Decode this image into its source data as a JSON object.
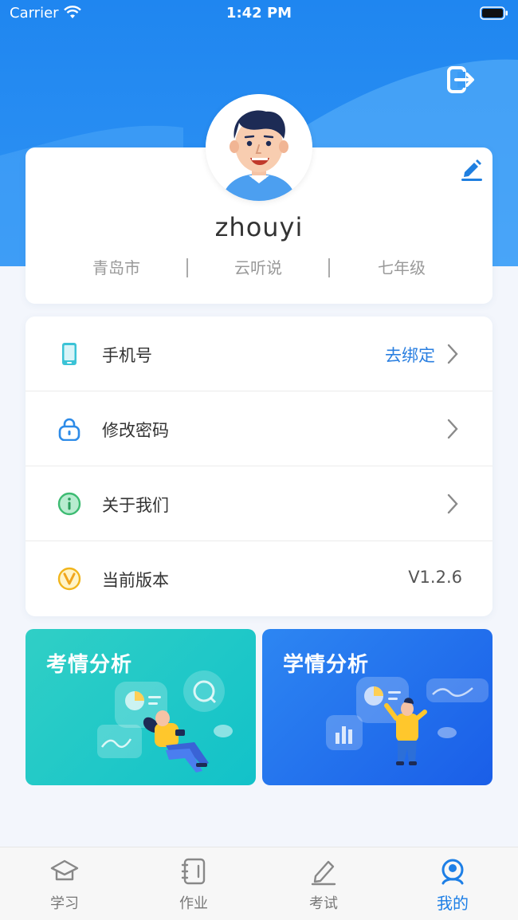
{
  "status_bar": {
    "carrier": "Carrier",
    "time": "1:42 PM"
  },
  "profile": {
    "username": "zhouyi",
    "city": "青岛市",
    "school": "云听说",
    "grade": "七年级"
  },
  "menu": [
    {
      "icon": "phone-icon",
      "label": "手机号",
      "action": "去绑定"
    },
    {
      "icon": "lock-icon",
      "label": "修改密码"
    },
    {
      "icon": "info-icon",
      "label": "关于我们"
    },
    {
      "icon": "version-icon",
      "label": "当前版本",
      "value": "V1.2.6"
    }
  ],
  "tiles": [
    {
      "title": "考情分析"
    },
    {
      "title": "学情分析"
    }
  ],
  "tabbar": [
    {
      "icon": "graduation-cap-icon",
      "label": "学习",
      "active": false
    },
    {
      "icon": "notebook-icon",
      "label": "作业",
      "active": false
    },
    {
      "icon": "pencil-icon",
      "label": "考试",
      "active": false
    },
    {
      "icon": "profile-icon",
      "label": "我的",
      "active": true
    }
  ],
  "colors": {
    "primary": "#1f86f0",
    "accent_text": "#2a7fe0",
    "active_tab": "#1d7fe6",
    "teal_tile": "#1dc6c8",
    "blue_tile": "#2270ec"
  }
}
